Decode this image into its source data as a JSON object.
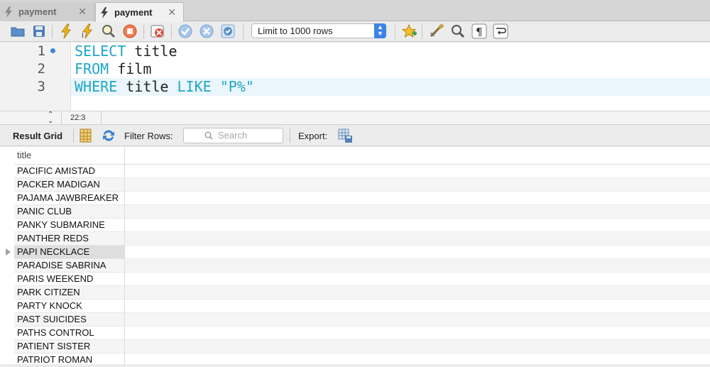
{
  "tabs": [
    {
      "label": "payment",
      "close": "✕",
      "active": false
    },
    {
      "label": "payment",
      "close": "✕",
      "active": true
    }
  ],
  "toolbar": {
    "limit_label": "Limit to 1000 rows",
    "icons": [
      "open-folder-icon",
      "save-icon",
      "execute-icon",
      "execute-current-icon",
      "explain-icon",
      "stop-icon",
      "toggle-error-icon",
      "commit-icon",
      "rollback-icon",
      "autocommit-icon",
      "limit-select",
      "bookmark-icon",
      "beautify-icon",
      "find-icon",
      "invisible-chars-icon",
      "wrap-icon"
    ]
  },
  "editor": {
    "lines": [
      {
        "num": "1",
        "parts": [
          {
            "t": "SELECT",
            "k": true
          },
          {
            "t": " title",
            "k": false
          }
        ]
      },
      {
        "num": "2",
        "parts": [
          {
            "t": "FROM",
            "k": true
          },
          {
            "t": " film",
            "k": false
          }
        ]
      },
      {
        "num": "3",
        "parts": [
          {
            "t": "WHERE",
            "k": true
          },
          {
            "t": " title ",
            "k": false
          },
          {
            "t": "LIKE",
            "k": true
          },
          {
            "t": " ",
            "k": false
          },
          {
            "t": "\"P%\"",
            "k": true
          }
        ]
      }
    ],
    "cursor_pos": "22:3"
  },
  "results": {
    "grid_label": "Result Grid",
    "filter_label": "Filter Rows:",
    "search_placeholder": "Search",
    "export_label": "Export:",
    "column": "title",
    "rows": [
      "PACIFIC AMISTAD",
      "PACKER MADIGAN",
      "PAJAMA JAWBREAKER",
      "PANIC CLUB",
      "PANKY SUBMARINE",
      "PANTHER REDS",
      "PAPI NECKLACE",
      "PARADISE SABRINA",
      "PARIS WEEKEND",
      "PARK CITIZEN",
      "PARTY KNOCK",
      "PAST SUICIDES",
      "PATHS CONTROL",
      "PATIENT SISTER",
      "PATRIOT ROMAN"
    ],
    "selected_index": 6
  },
  "colors": {
    "keyword": "#20a6c9",
    "accent": "#3b83e6"
  }
}
